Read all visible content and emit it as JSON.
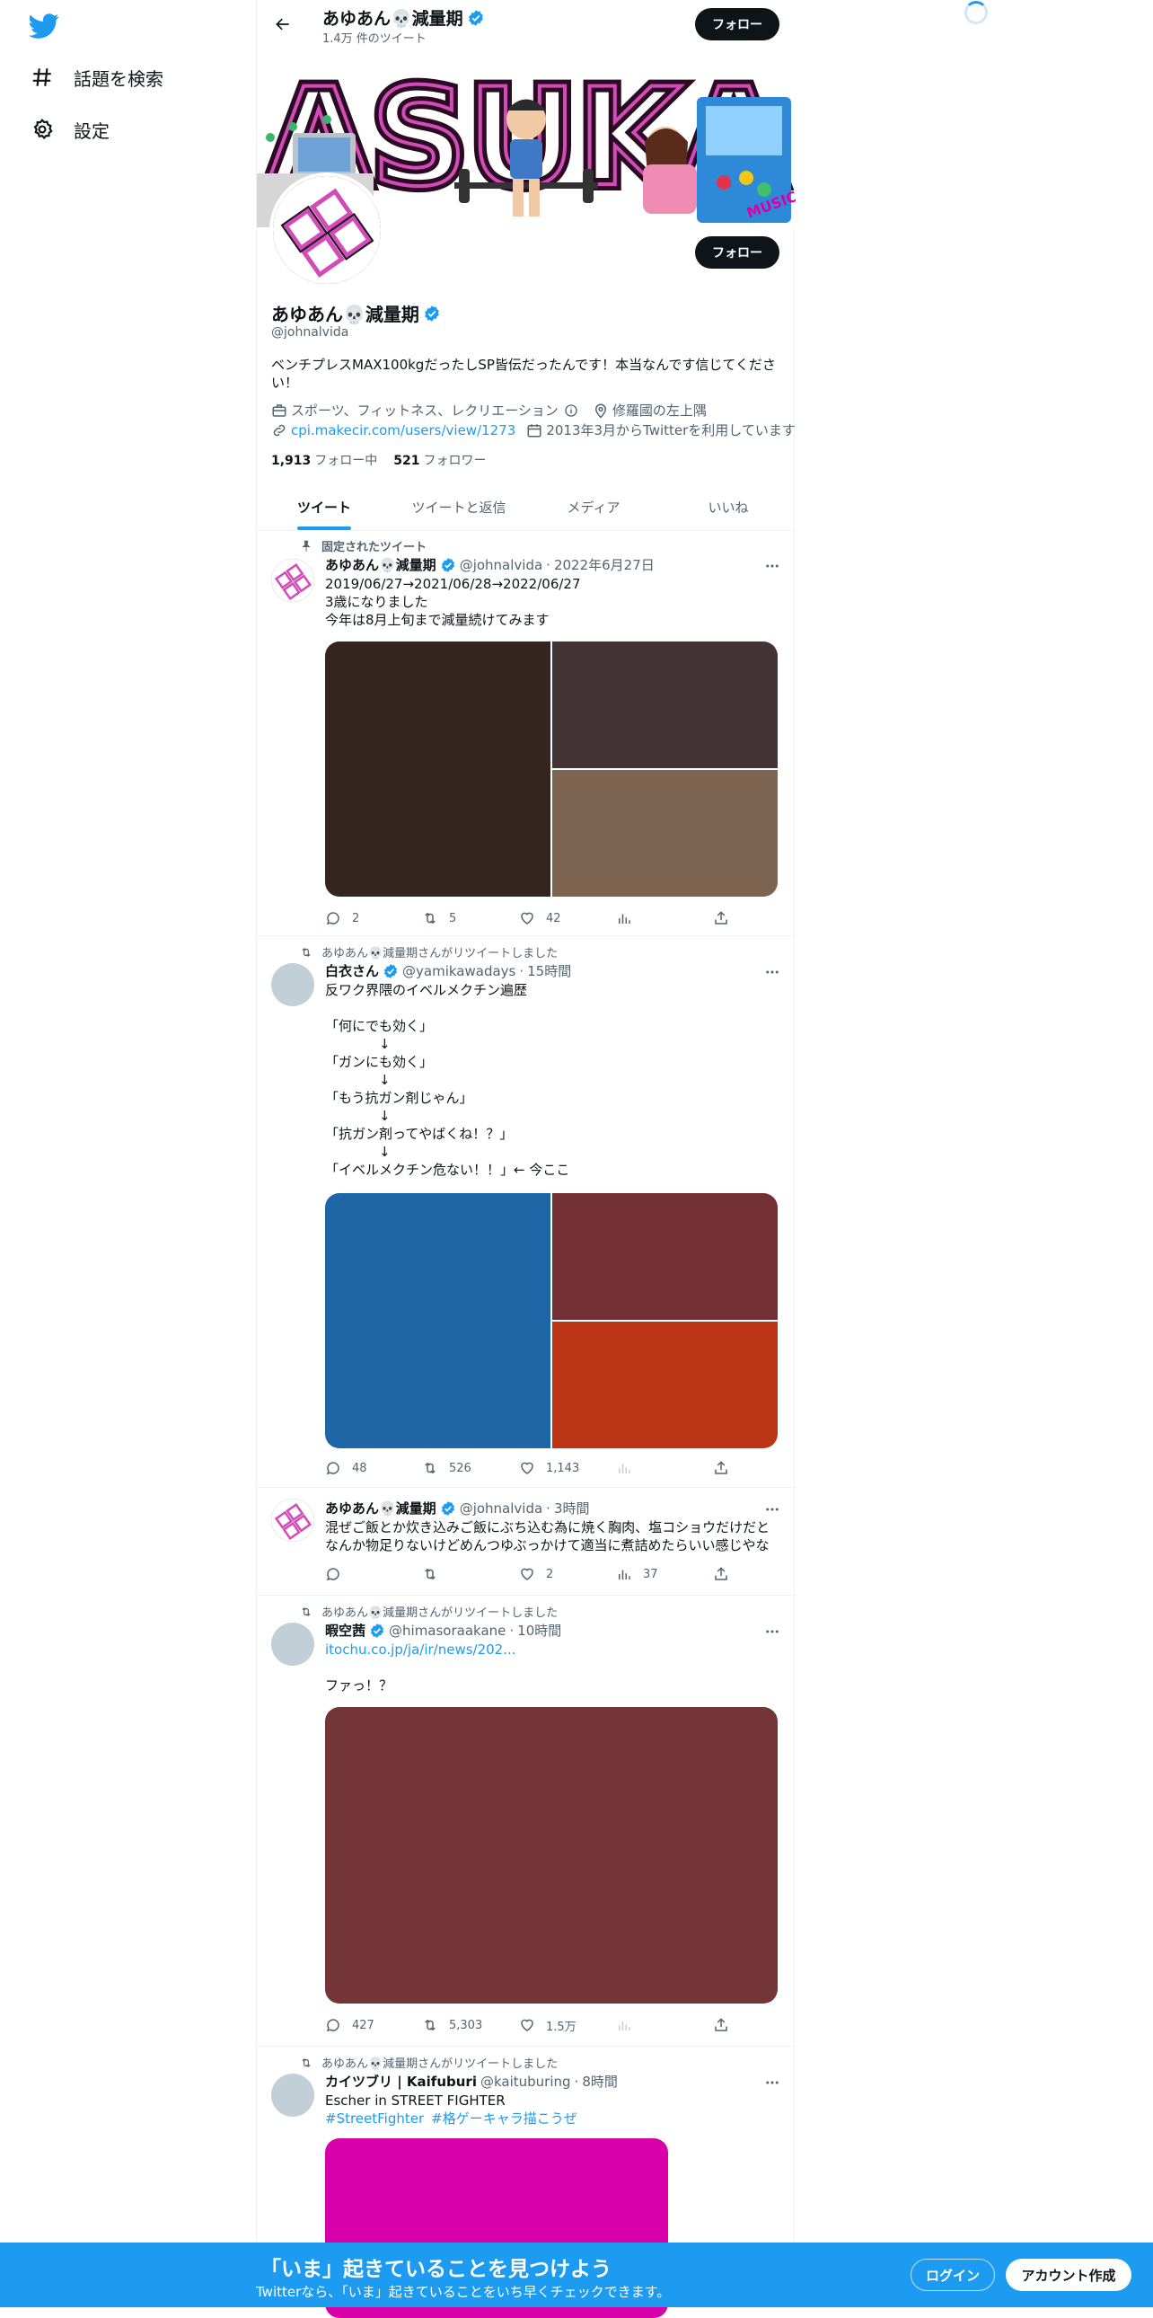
{
  "left_nav": {
    "items": [
      {
        "label": "話題を検索",
        "icon": "hashtag-icon"
      },
      {
        "label": "設定",
        "icon": "gear-icon"
      }
    ]
  },
  "header": {
    "name": "あゆあん💀減量期",
    "tweet_count": "1.4万 件のツイート",
    "follow_label": "フォロー"
  },
  "banner": {
    "text": "ASUKA",
    "sign_text": "MUSIC"
  },
  "profile": {
    "follow_label": "フォロー",
    "name": "あゆあん💀減量期",
    "handle": "@johnalvida",
    "bio": "ベンチプレスMAX100kgだったしSP皆伝だったんです！本当なんです信じてください！",
    "category": "スポーツ、フィットネス、レクリエーション",
    "location": "修羅國の左上隅",
    "url": "cpi.makecir.com/users/view/1273",
    "joined": "2013年3月からTwitterを利用しています",
    "following_count": "1,913",
    "following_label": "フォロー中",
    "followers_count": "521",
    "followers_label": "フォロワー"
  },
  "tabs": [
    "ツイート",
    "ツイートと返信",
    "メディア",
    "いいね"
  ],
  "tweets": [
    {
      "context": "固定されたツイート",
      "name": "あゆあん💀減量期",
      "handle": "@johnalvida",
      "time": "2022年6月27日",
      "text": "2019/06/27→2021/06/28→2022/06/27\n3歳になりました\n今年は8月上旬まで減量続けてみます",
      "replies": "2",
      "retweets": "5",
      "likes": "42",
      "views": "",
      "colors": [
        "#342520",
        "#433535",
        "#7e6552"
      ]
    },
    {
      "context": "あゆあん💀減量期さんがリツイートしました",
      "name": "白衣さん",
      "handle": "@yamikawadays",
      "time": "15時間",
      "text": "反ワク界隈のイベルメクチン遍歴\n\n「何にでも効く」\n　　　　↓\n「ガンにも効く」\n　　　　↓\n「もう抗ガン剤じゃん」\n　　　　↓\n「抗ガン剤ってやばくね！？」\n　　　　↓\n「イベルメクチン危ない！！」← 今ここ",
      "replies": "48",
      "retweets": "526",
      "likes": "1,143",
      "views": "",
      "colors": [
        "#1f66a6",
        "#722f34",
        "#bb3515"
      ]
    },
    {
      "context": "",
      "name": "あゆあん💀減量期",
      "handle": "@johnalvida",
      "time": "3時間",
      "text": "混ぜご飯とか炊き込みご飯にぶち込む為に焼く胸肉、塩コショウだけだと\nなんか物足りないけどめんつゆぶっかけて適当に煮詰めたらいい感じやな",
      "replies": "",
      "retweets": "",
      "likes": "2",
      "views": "37",
      "colors": []
    },
    {
      "context": "あゆあん💀減量期さんがリツイートしました",
      "name": "暇空茜",
      "handle": "@himasoraakane",
      "time": "10時間",
      "link": "itochu.co.jp/ja/ir/news/202...",
      "text": "ファっ！？",
      "replies": "427",
      "retweets": "5,303",
      "likes": "1.5万",
      "views": "",
      "colors": [
        "#733537"
      ]
    },
    {
      "context": "あゆあん💀減量期さんがリツイートしました",
      "name": "カイツブリ | Kaifuburi",
      "handle": "@kaituburing",
      "time": "8時間",
      "text": "Escher in STREET FIGHTER",
      "hashtags": [
        "#StreetFighter",
        "#格ゲーキャラ描こうぜ"
      ],
      "replies": "",
      "retweets": "",
      "likes": "",
      "views": "",
      "colors": [
        "#d800a8"
      ]
    }
  ],
  "bottom_bar": {
    "title": "「いま」起きていることを見つけよう",
    "subtitle": "Twitterなら、「いま」起きていることをいち早くチェックできます。",
    "login": "ログイン",
    "signup": "アカウント作成"
  }
}
